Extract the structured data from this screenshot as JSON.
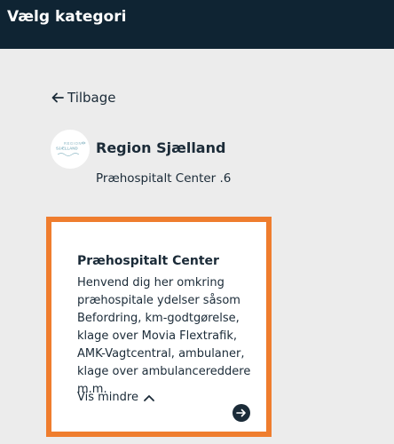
{
  "header": {
    "title": "Vælg kategori"
  },
  "nav": {
    "back_label": "Tilbage"
  },
  "organization": {
    "name": "Region Sjælland",
    "subtitle": "Præhospitalt Center .6",
    "logo_text_top": "REGION",
    "logo_text_mid": "SJÆLLAND",
    "logo_text_bottom": "- med borgeren",
    "logo_color": "#8fb9c6"
  },
  "card": {
    "title": "Præhospitalt Center",
    "description": "Henvend dig her omkring præhospitale ydelser såsom Befordring, km-godtgørelse, klage over Movia Flextrafik, AMK-Vagtcentral, ambulaner, klage over ambulancereddere m.m.",
    "toggle_label": "Vis mindre",
    "border_color": "#ef7d2e",
    "icons": {
      "toggle": "chevron-up-icon",
      "go": "arrow-right-circle-icon"
    }
  },
  "colors": {
    "header_bg": "#0f2433",
    "page_bg": "#ececec",
    "text": "#1b2b38"
  }
}
